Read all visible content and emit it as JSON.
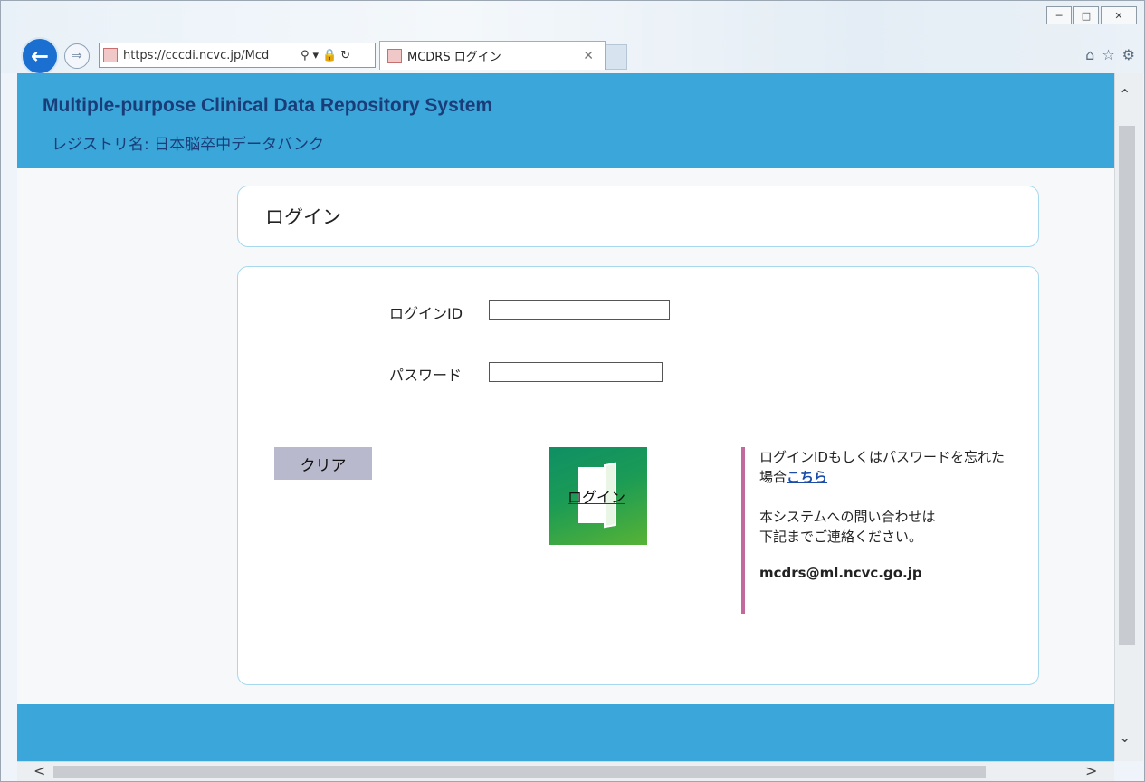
{
  "browser": {
    "url": "https://cccdi.ncvc.jp/Mcd",
    "tab_title": "MCDRS ログイン",
    "window_controls": [
      "minimize-icon",
      "maximize-icon",
      "close-icon"
    ],
    "toolbar_icons": [
      "home-icon",
      "star-icon",
      "gear-icon"
    ]
  },
  "header": {
    "system_title": "Multiple-purpose Clinical Data Repository System",
    "registry_label": "レジストリ名: 日本脳卒中データバンク"
  },
  "login": {
    "page_title": "ログイン",
    "id_label": "ログインID",
    "id_value": "",
    "password_label": "パスワード",
    "password_value": "",
    "clear_button": "クリア",
    "login_button": "ログイン"
  },
  "info": {
    "forgot_text": "ログインIDもしくはパスワードを忘れた場合",
    "forgot_link": "こちら",
    "contact_line1": "本システムへの問い合わせは",
    "contact_line2": "下記までご連絡ください。",
    "email": "mcdrs@ml.ncvc.go.jp"
  },
  "colors": {
    "header_bg": "#3aa6d9",
    "title_text": "#1a3c78",
    "clear_button_bg": "#b9b9cd",
    "login_button_green": "#1b9b55",
    "info_accent": "#c26a9e"
  }
}
